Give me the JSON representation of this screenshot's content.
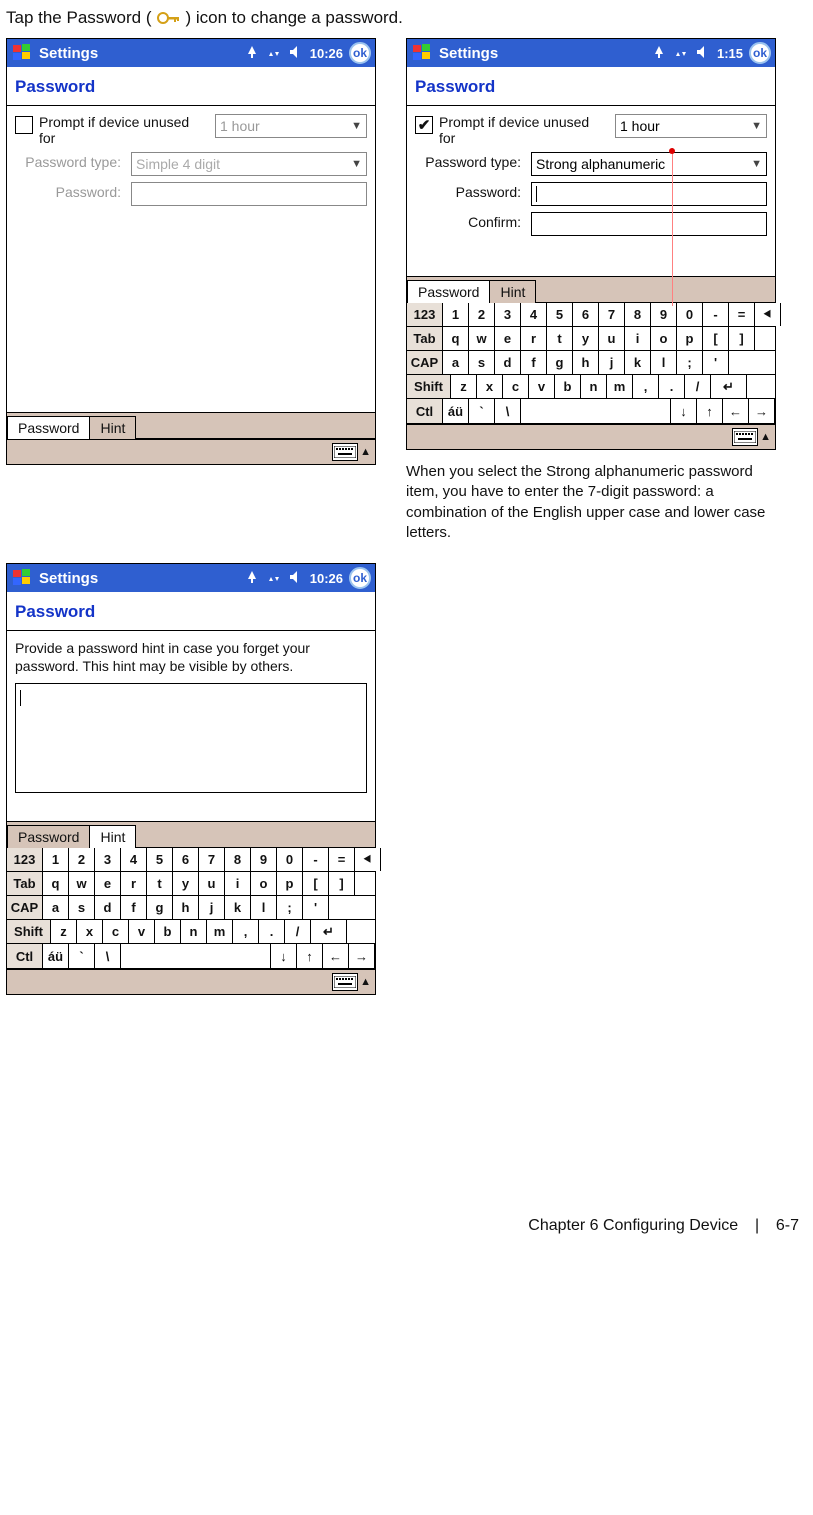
{
  "intro": {
    "before": "Tap the Password (",
    "after": ") icon to change a password."
  },
  "titlebar_label": "Settings",
  "ok_label": "ok",
  "section_title": "Password",
  "tabs": {
    "password": "Password",
    "hint": "Hint"
  },
  "screen1": {
    "time": "10:26",
    "prompt_checked": false,
    "prompt_label": "Prompt if device unused for",
    "duration": "1 hour",
    "type_label": "Password type:",
    "type_value": "Simple 4 digit",
    "password_label": "Password:",
    "password_value": "",
    "active_tab": "password"
  },
  "screen2": {
    "time": "1:15",
    "prompt_checked": true,
    "prompt_label": "Prompt if device unused for",
    "duration": "1 hour",
    "type_label": "Password type:",
    "type_value": "Strong alphanumeric",
    "password_label": "Password:",
    "password_value": "",
    "confirm_label": "Confirm:",
    "confirm_value": "",
    "active_tab": "password"
  },
  "screen2_caption": "When you select the Strong alphanumeric password item, you have to enter the 7-digit password: a combination of the English upper case and lower case letters.",
  "screen3": {
    "time": "10:26",
    "hint_text": "Provide a password hint in case you forget your password.  This hint may be visible by others.",
    "textarea_value": "",
    "active_tab": "hint"
  },
  "keyboard": {
    "row1_label": "123",
    "row1": [
      "1",
      "2",
      "3",
      "4",
      "5",
      "6",
      "7",
      "8",
      "9",
      "0",
      "-",
      "="
    ],
    "row2_label": "Tab",
    "row2": [
      "q",
      "w",
      "e",
      "r",
      "t",
      "y",
      "u",
      "i",
      "o",
      "p",
      "[",
      "]"
    ],
    "row3_label": "CAP",
    "row3": [
      "a",
      "s",
      "d",
      "f",
      "g",
      "h",
      "j",
      "k",
      "l",
      ";",
      "'"
    ],
    "row4_label": "Shift",
    "row4": [
      "z",
      "x",
      "c",
      "v",
      "b",
      "n",
      "m",
      ",",
      ".",
      "/"
    ],
    "row5_label": "Ctl",
    "row5_a": "áü",
    "row5_b": "`",
    "row5_c": "\\",
    "arrows": [
      "↓",
      "↑",
      "←",
      "→"
    ],
    "backspace": "⯇",
    "enter": "↵"
  },
  "footer": {
    "chapter": "Chapter 6 Configuring Device",
    "page": "6-7"
  }
}
